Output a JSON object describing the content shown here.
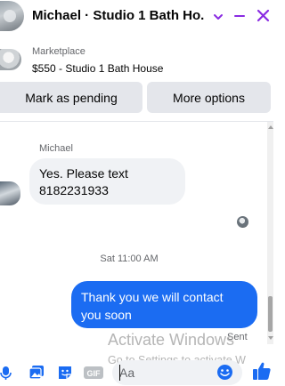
{
  "header": {
    "title": "Michael · Studio 1 Bath Ho...",
    "icons": [
      "chevron-down-icon",
      "minimize-icon",
      "close-icon"
    ],
    "accent_color": "#8a2be2"
  },
  "listing": {
    "label": "Marketplace",
    "item": "$550 - Studio 1 Bath House"
  },
  "actions": {
    "pending_label": "Mark as pending",
    "options_label": "More options"
  },
  "conversation": {
    "sender_name": "Michael",
    "incoming_line1": "Yes. Please text",
    "incoming_line2": "8182231933",
    "timestamp": "Sat 11:00 AM",
    "outgoing_line1": "Thank you we will contact",
    "outgoing_line2": "you soon",
    "status": "Sent"
  },
  "watermark": {
    "line1": "Activate Windows",
    "line2": "Go to Settings to activate W"
  },
  "composer": {
    "placeholder": "Aa",
    "icons": [
      "microphone-icon",
      "photo-icon",
      "sticker-icon",
      "gif-icon",
      "emoji-icon",
      "thumbs-up-icon"
    ],
    "gif_label": "GIF"
  },
  "colors": {
    "messenger_blue": "#1b6cf2",
    "gray_bubble": "#f0f2f5",
    "button_gray": "#e4e6eb"
  }
}
